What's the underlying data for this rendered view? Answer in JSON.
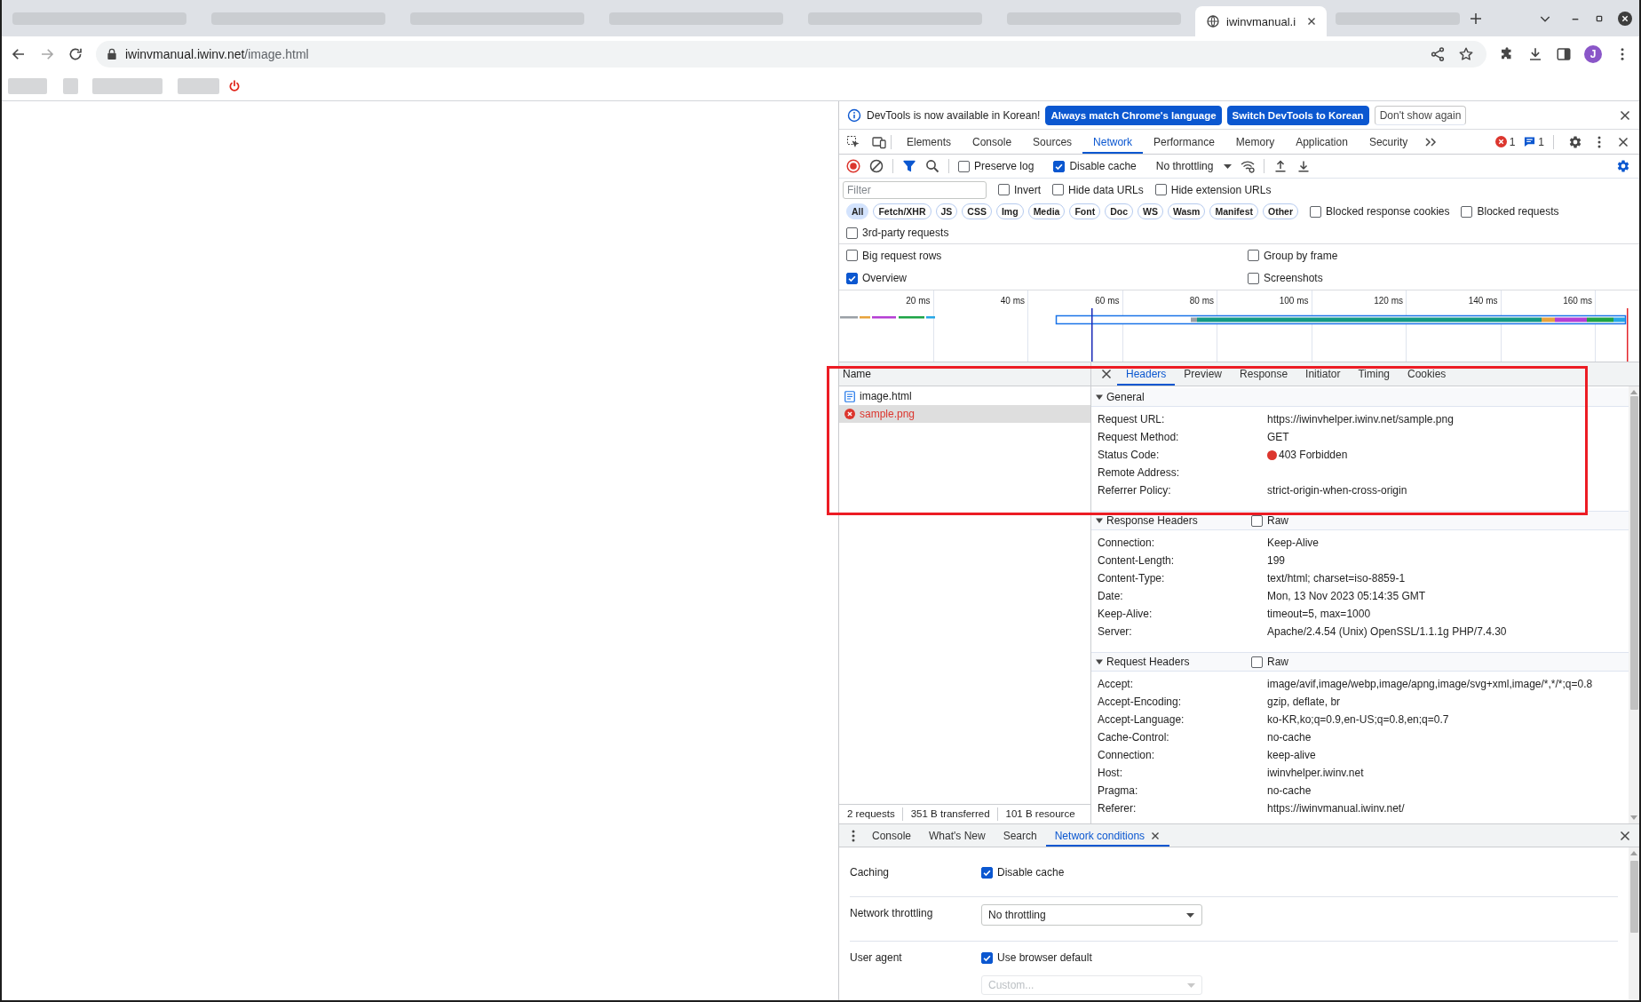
{
  "browser": {
    "tab": {
      "title": "iwinvmanual.i",
      "selected": true
    },
    "address": {
      "host": "iwinvmanual.iwinv.net",
      "path": "/image.html"
    },
    "profile": "J"
  },
  "devtools": {
    "infobar": {
      "message": "DevTools is now available in Korean!",
      "buttons": [
        {
          "label": "Always match Chrome's language",
          "kind": "primary"
        },
        {
          "label": "Switch DevTools to Korean",
          "kind": "primary"
        },
        {
          "label": "Don't show again",
          "kind": "secondary"
        }
      ]
    },
    "panel_tabs": [
      {
        "label": "Elements",
        "selected": false
      },
      {
        "label": "Console",
        "selected": false
      },
      {
        "label": "Sources",
        "selected": false
      },
      {
        "label": "Network",
        "selected": true
      },
      {
        "label": "Performance",
        "selected": false
      },
      {
        "label": "Memory",
        "selected": false
      },
      {
        "label": "Application",
        "selected": false
      },
      {
        "label": "Security",
        "selected": false
      }
    ],
    "error_count": "1",
    "message_count": "1",
    "toolbar": {
      "recording": true,
      "filter_active": true,
      "options": [
        {
          "label": "Preserve log",
          "checked": false
        },
        {
          "label": "Disable cache",
          "checked": true
        }
      ],
      "throttling": "No throttling",
      "settings_open": true
    },
    "filter": {
      "placeholder": "Filter",
      "options": [
        {
          "label": "Invert",
          "checked": false
        },
        {
          "label": "Hide data URLs",
          "checked": false
        },
        {
          "label": "Hide extension URLs",
          "checked": false
        }
      ]
    },
    "types": [
      {
        "label": "All",
        "selected": true
      },
      {
        "label": "Fetch/XHR",
        "selected": false
      },
      {
        "label": "JS",
        "selected": false
      },
      {
        "label": "CSS",
        "selected": false
      },
      {
        "label": "Img",
        "selected": false
      },
      {
        "label": "Media",
        "selected": false
      },
      {
        "label": "Font",
        "selected": false
      },
      {
        "label": "Doc",
        "selected": false
      },
      {
        "label": "WS",
        "selected": false
      },
      {
        "label": "Wasm",
        "selected": false
      },
      {
        "label": "Manifest",
        "selected": false
      },
      {
        "label": "Other",
        "selected": false
      }
    ],
    "type_options": [
      {
        "label": "Blocked response cookies",
        "checked": false
      },
      {
        "label": "Blocked requests",
        "checked": false
      }
    ],
    "third_party": {
      "label": "3rd-party requests",
      "checked": false
    },
    "settings": [
      {
        "label": "Big request rows",
        "checked": false
      },
      {
        "label": "Group by frame",
        "checked": false
      },
      {
        "label": "Overview",
        "checked": true
      },
      {
        "label": "Screenshots",
        "checked": false
      }
    ],
    "overview": {
      "ticks": [
        "20 ms",
        "40 ms",
        "60 ms",
        "80 ms",
        "100 ms",
        "120 ms",
        "140 ms",
        "160 ms"
      ]
    },
    "requests": {
      "column": "Name",
      "rows": [
        {
          "name": "image.html",
          "kind": "document",
          "failed": false,
          "selected": false
        },
        {
          "name": "sample.png",
          "failed": true,
          "selected": true
        }
      ],
      "summary": [
        "2 requests",
        "351 B transferred",
        "101 B resource"
      ]
    },
    "details": {
      "tabs": [
        {
          "label": "Headers",
          "selected": true
        },
        {
          "label": "Preview",
          "selected": false
        },
        {
          "label": "Response",
          "selected": false
        },
        {
          "label": "Initiator",
          "selected": false
        },
        {
          "label": "Timing",
          "selected": false
        },
        {
          "label": "Cookies",
          "selected": false
        }
      ],
      "sections": [
        {
          "title": "General",
          "expanded": true,
          "rows": [
            {
              "name": "Request URL:",
              "value": "https://iwinvhelper.iwinv.net/sample.png"
            },
            {
              "name": "Request Method:",
              "value": "GET"
            },
            {
              "name": "Status Code:",
              "value": "403 Forbidden",
              "color": "#dc362e"
            },
            {
              "name": "Remote Address:"
            },
            {
              "name": "Referrer Policy:",
              "value": "strict-origin-when-cross-origin"
            }
          ]
        },
        {
          "title": "Response Headers",
          "expanded": true,
          "raw": {
            "label": "Raw",
            "checked": false
          },
          "rows": [
            {
              "name": "Connection:",
              "value": "Keep-Alive"
            },
            {
              "name": "Content-Length:",
              "value": "199"
            },
            {
              "name": "Content-Type:",
              "value": "text/html; charset=iso-8859-1"
            },
            {
              "name": "Date:",
              "value": "Mon, 13 Nov 2023 05:14:35 GMT"
            },
            {
              "name": "Keep-Alive:",
              "value": "timeout=5, max=1000"
            },
            {
              "name": "Server:",
              "value": "Apache/2.4.54 (Unix) OpenSSL/1.1.1g PHP/7.4.30"
            }
          ]
        },
        {
          "title": "Request Headers",
          "expanded": true,
          "raw": {
            "label": "Raw",
            "checked": false
          },
          "rows": [
            {
              "name": "Accept:",
              "value": "image/avif,image/webp,image/apng,image/svg+xml,image/*,*/*;q=0.8"
            },
            {
              "name": "Accept-Encoding:",
              "value": "gzip, deflate, br"
            },
            {
              "name": "Accept-Language:",
              "value": "ko-KR,ko;q=0.9,en-US;q=0.8,en;q=0.7"
            },
            {
              "name": "Cache-Control:",
              "value": "no-cache"
            },
            {
              "name": "Connection:",
              "value": "keep-alive"
            },
            {
              "name": "Host:",
              "value": "iwinvhelper.iwinv.net"
            },
            {
              "name": "Pragma:",
              "value": "no-cache"
            },
            {
              "name": "Referer:",
              "value": "https://iwinvmanual.iwinv.net/"
            }
          ]
        }
      ]
    },
    "drawer": {
      "tabs": [
        {
          "label": "Console",
          "selected": false,
          "closable": false
        },
        {
          "label": "What's New",
          "selected": false,
          "closable": false
        },
        {
          "label": "Search",
          "selected": false,
          "closable": false
        },
        {
          "label": "Network conditions",
          "selected": true,
          "closable": true
        }
      ],
      "conditions": [
        {
          "label": "Caching",
          "kind": "checkbox",
          "option": "Disable cache",
          "checked": true
        },
        {
          "label": "Network throttling",
          "kind": "select",
          "value": "No throttling"
        },
        {
          "label": "User agent",
          "kind": "checkbox",
          "option": "Use browser default",
          "checked": true,
          "custom": {
            "placeholder": "Custom...",
            "disabled": true
          }
        }
      ]
    }
  }
}
